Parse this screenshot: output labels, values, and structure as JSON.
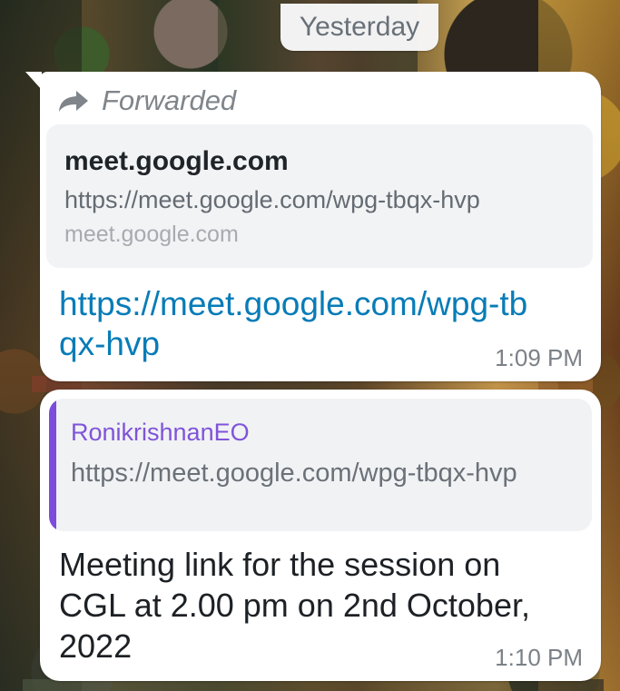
{
  "chat": {
    "date_chip": "Yesterday",
    "messages": [
      {
        "forwarded_label": "Forwarded",
        "preview": {
          "title": "meet.google.com",
          "url": "https://meet.google.com/wpg-tbqx-hvp",
          "domain": "meet.google.com"
        },
        "text": "https://meet.google.com/wpg-tbqx-hvp",
        "time": "1:09 PM"
      },
      {
        "quote": {
          "author": "RonikrishnanEO",
          "text": "https://meet.google.com/wpg-tbqx-hvp"
        },
        "text": "Meeting link for the session on CGL at 2.00 pm on 2nd October, 2022",
        "time": "1:10 PM"
      }
    ]
  },
  "colors": {
    "link": "#087cb7",
    "quote_accent": "#7c4ddb",
    "timestamp": "#7b8187"
  },
  "icons": {
    "forwarded": "forward-arrow-icon"
  }
}
